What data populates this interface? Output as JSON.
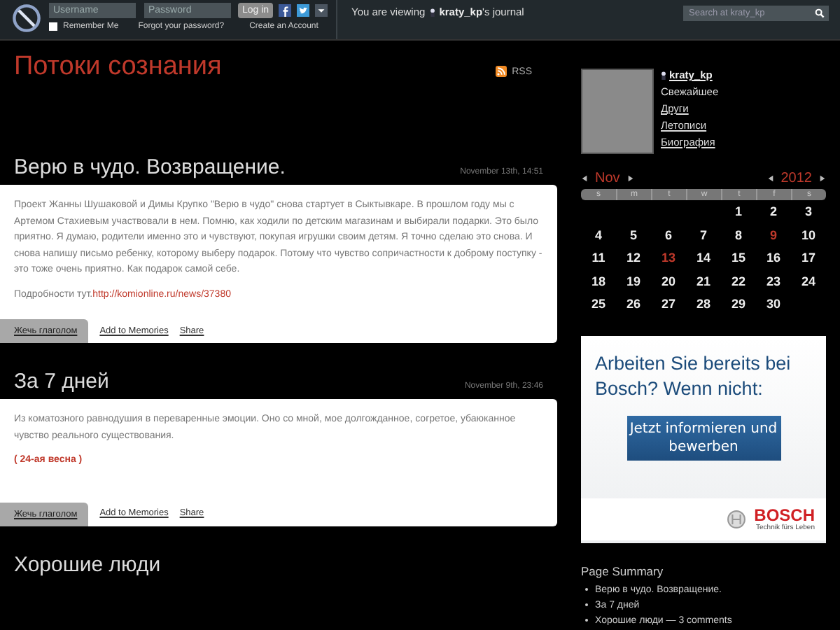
{
  "topbar": {
    "username_placeholder": "Username",
    "password_placeholder": "Password",
    "login": "Log in",
    "remember": {
      "label": "Remember Me",
      "checked": false
    },
    "forgot": "Forgot your password?",
    "create": "Create an Account",
    "viewing_prefix": "You are viewing",
    "viewing_user": "kraty_kp",
    "viewing_suffix": "'s journal",
    "search_placeholder": "Search at kraty_kp"
  },
  "journal": {
    "title": "Потоки сознания",
    "rss": "RSS"
  },
  "posts": [
    {
      "title": "Верю в чудо. Возвращение.",
      "date": "November 13th, 14:51",
      "paragraphs": [
        "Проект Жанны Шушаковой и Димы Крупко \"Верю в чудо\" снова стартует в Сыктывкаре. В прошлом году мы с Артемом Стахиевым участвовали в нем. Помню, как ходили по детским магазинам и выбирали подарки. Это было приятно. Я думаю, родители именно это и чувствуют, покупая игрушки своим детям. Я точно сделаю это снова. И снова напишу письмо ребенку, которому выберу подарок. Потому что чувство сопричастности к доброму поступку - это тоже очень приятно. Как подарок самой себе."
      ],
      "more_label": "Подробности тут.",
      "more_link": "http://komionline.ru/news/37380",
      "actions": [
        "Жечь глаголом",
        "Add to Memories",
        "Share"
      ]
    },
    {
      "title": "За 7 дней",
      "date": "November 9th, 23:46",
      "paragraphs": [
        "Из коматозного равнодушия в переваренные эмоции. Оно со мной, мое долгожданное, согретое, убаюканное чувство реального существования."
      ],
      "tag": "( 24-ая весна )",
      "actions": [
        "Жечь глаголом",
        "Add to Memories",
        "Share"
      ]
    },
    {
      "title": "Хорошие люди"
    }
  ],
  "profile": {
    "username": "kraty_kp",
    "links": [
      {
        "label": "Свежайшее",
        "selected": true
      },
      {
        "label": "Други",
        "selected": false
      },
      {
        "label": "Летописи",
        "selected": false
      },
      {
        "label": "Биография",
        "selected": false
      }
    ]
  },
  "calendar": {
    "month": "Nov",
    "year": "2012",
    "weekdays": [
      "s",
      "m",
      "t",
      "w",
      "t",
      "f",
      "s"
    ],
    "weeks": [
      {
        "days": [
          {
            "day": "1",
            "highlighted": false
          },
          {
            "day": "2",
            "highlighted": false
          },
          {
            "day": "3",
            "highlighted": false
          }
        ]
      },
      {
        "days": [
          {
            "day": "4",
            "highlighted": false
          },
          {
            "day": "5",
            "highlighted": false
          },
          {
            "day": "6",
            "highlighted": false
          },
          {
            "day": "7",
            "highlighted": false
          },
          {
            "day": "8",
            "highlighted": false
          },
          {
            "day": "9",
            "highlighted": true
          },
          {
            "day": "10",
            "highlighted": false
          }
        ]
      },
      {
        "days": [
          {
            "day": "11",
            "highlighted": false
          },
          {
            "day": "12",
            "highlighted": false
          },
          {
            "day": "13",
            "highlighted": true
          },
          {
            "day": "14",
            "highlighted": false
          },
          {
            "day": "15",
            "highlighted": false
          },
          {
            "day": "16",
            "highlighted": false
          },
          {
            "day": "17",
            "highlighted": false
          }
        ]
      },
      {
        "days": [
          {
            "day": "18",
            "highlighted": false
          },
          {
            "day": "19",
            "highlighted": false
          },
          {
            "day": "20",
            "highlighted": false
          },
          {
            "day": "21",
            "highlighted": false
          },
          {
            "day": "22",
            "highlighted": false
          },
          {
            "day": "23",
            "highlighted": false
          },
          {
            "day": "24",
            "highlighted": false
          }
        ]
      },
      {
        "days": [
          {
            "day": "25",
            "highlighted": false
          },
          {
            "day": "26",
            "highlighted": false
          },
          {
            "day": "27",
            "highlighted": false
          },
          {
            "day": "28",
            "highlighted": false
          },
          {
            "day": "29",
            "highlighted": false
          },
          {
            "day": "30",
            "highlighted": false
          }
        ]
      }
    ]
  },
  "ad": {
    "headline": "Arbeiten Sie bereits bei Bosch? Wenn nicht:",
    "button": "Jetzt informieren und bewerben",
    "brand": "BOSCH",
    "slogan": "Technik fürs Leben"
  },
  "summary": {
    "title": "Page Summary",
    "items": [
      "Верю в чудо. Возвращение.",
      "За 7 дней",
      "Хорошие люди — 3 comments"
    ]
  }
}
